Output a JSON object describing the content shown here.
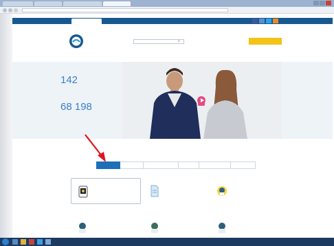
{
  "browser": {
    "tabs": [
      "",
      "",
      "",
      ""
    ],
    "url": ""
  },
  "site_nav": {
    "tabs": [
      "",
      ""
    ]
  },
  "header": {
    "logo_text": "",
    "city": "",
    "search_placeholder": "",
    "phone_note": "",
    "phone": "",
    "login": "",
    "cta": ""
  },
  "hero": {
    "stat1_value": "142",
    "stat1_label": "",
    "stat2_value": "68 198",
    "stat2_label": ""
  },
  "services": {
    "title": "",
    "tabs": [
      "",
      "",
      "",
      "",
      "",
      ""
    ],
    "active_tab": 0,
    "cards": [
      {
        "label": "",
        "icon": "cardio-monitor-icon"
      },
      {
        "label": "",
        "icon": "document-icon"
      },
      {
        "label": "",
        "icon": "doctor-avatar-icon"
      },
      {
        "label": "",
        "icon": "doctor-avatar-icon"
      },
      {
        "label": "",
        "icon": "doctor-avatar-icon"
      },
      {
        "label": "",
        "icon": "doctor-avatar-icon"
      }
    ]
  },
  "taskbar": {
    "tray_text": ""
  },
  "colors": {
    "brand_blue": "#17598f",
    "accent_yellow": "#f3c318",
    "stat_blue": "#3a80c9",
    "arrow_red": "#e0131f",
    "taskbar": "#1c3a60"
  }
}
